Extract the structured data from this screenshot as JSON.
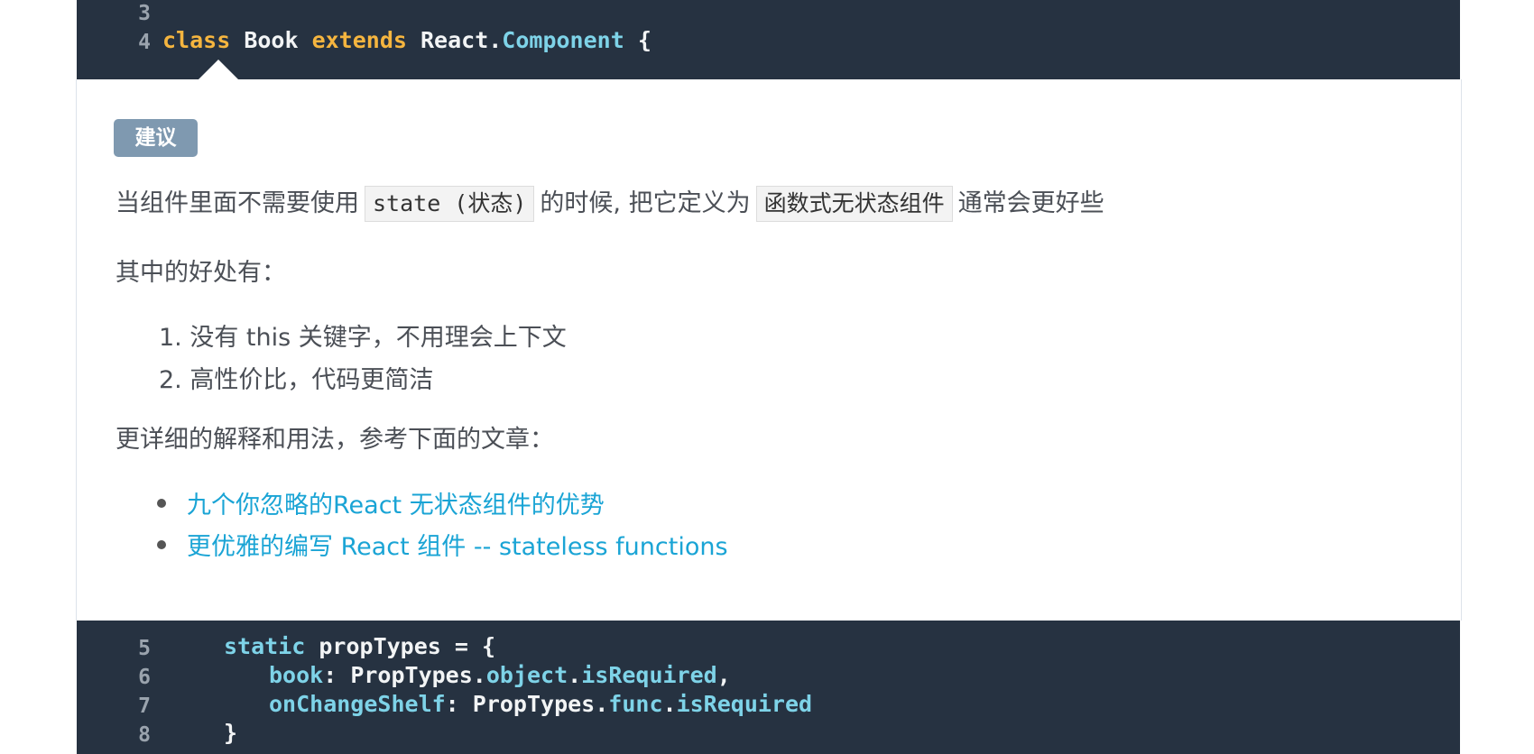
{
  "code_top": {
    "lines": [
      {
        "num": "3",
        "tokens": []
      },
      {
        "num": "4",
        "tokens": [
          {
            "text": "class",
            "kind": "kw"
          },
          {
            "text": " Book ",
            "kind": "cls"
          },
          {
            "text": "extends",
            "kind": "kw"
          },
          {
            "text": " React.",
            "kind": "cls"
          },
          {
            "text": "Component",
            "kind": "prop"
          },
          {
            "text": " {",
            "kind": "cls"
          }
        ]
      }
    ]
  },
  "review": {
    "badge": "建议",
    "para1": {
      "before": "当组件里面不需要使用",
      "code1": "state (状态)",
      "middle": "的时候, 把它定义为",
      "code2": "函数式无状态组件",
      "after": "通常会更好些"
    },
    "para2": "其中的好处有：",
    "benefits": [
      "1. 没有 this 关键字，不用理会上下文",
      "2. 高性价比，代码更简洁"
    ],
    "para3": "更详细的解释和用法，参考下面的文章：",
    "links": [
      "九个你忽略的React 无状态组件的优势",
      "更优雅的编写 React 组件 -- stateless functions"
    ]
  },
  "code_bottom": {
    "lines": [
      {
        "num": "5",
        "indent": "   ",
        "tokens": [
          {
            "text": "static",
            "kind": "prop"
          },
          {
            "text": " propTypes = {",
            "kind": "cls"
          }
        ]
      },
      {
        "num": "6",
        "indent": "      ",
        "tokens": [
          {
            "text": "book",
            "kind": "prop"
          },
          {
            "text": ": PropTypes.",
            "kind": "cls"
          },
          {
            "text": "object",
            "kind": "prop"
          },
          {
            "text": ".",
            "kind": "cls"
          },
          {
            "text": "isRequired",
            "kind": "prop"
          },
          {
            "text": ",",
            "kind": "cls"
          }
        ]
      },
      {
        "num": "7",
        "indent": "      ",
        "tokens": [
          {
            "text": "onChangeShelf",
            "kind": "prop"
          },
          {
            "text": ": PropTypes.",
            "kind": "cls"
          },
          {
            "text": "func",
            "kind": "prop"
          },
          {
            "text": ".",
            "kind": "cls"
          },
          {
            "text": "isRequired",
            "kind": "prop"
          }
        ]
      },
      {
        "num": "8",
        "indent": "   ",
        "tokens": [
          {
            "text": "}",
            "kind": "cls"
          }
        ]
      }
    ]
  }
}
